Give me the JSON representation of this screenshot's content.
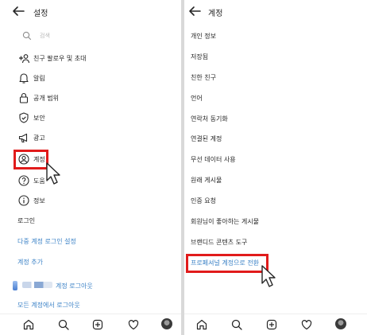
{
  "left_panel": {
    "title": "설정",
    "search_placeholder": "검색",
    "items": [
      {
        "label": "친구 팔로우 및 초대",
        "icon": "add-person-icon"
      },
      {
        "label": "알림",
        "icon": "bell-icon"
      },
      {
        "label": "공개 범위",
        "icon": "lock-icon"
      },
      {
        "label": "보안",
        "icon": "shield-icon"
      },
      {
        "label": "광고",
        "icon": "megaphone-icon"
      },
      {
        "label": "계정",
        "icon": "account-circle-icon"
      },
      {
        "label": "도움",
        "icon": "help-icon"
      },
      {
        "label": "정보",
        "icon": "info-icon"
      }
    ],
    "login_section": {
      "login": "로그인",
      "multi_account_login": "다중 계정 로그인 설정",
      "add_account": "계정 추가",
      "logout_account": "계정 로그아웃",
      "logout_all": "모든 계정에서 로그아웃"
    }
  },
  "right_panel": {
    "title": "계정",
    "items": [
      "개인 정보",
      "저장됨",
      "친한 친구",
      "언어",
      "연락처 동기화",
      "연결된 계정",
      "무선 데이터 사용",
      "원래 게시물",
      "인증 요청",
      "회원님이 좋아하는 게시물",
      "브랜디드 콘텐츠 도구"
    ],
    "switch_pro": "프로페셔널 계정으로 전환"
  },
  "bottom_nav": [
    "home-icon",
    "search-icon",
    "new-post-icon",
    "heart-icon",
    "profile-avatar"
  ],
  "colors": {
    "highlight": "#e11b1b",
    "link_blue": "#3d83c7",
    "text": "#262626"
  }
}
